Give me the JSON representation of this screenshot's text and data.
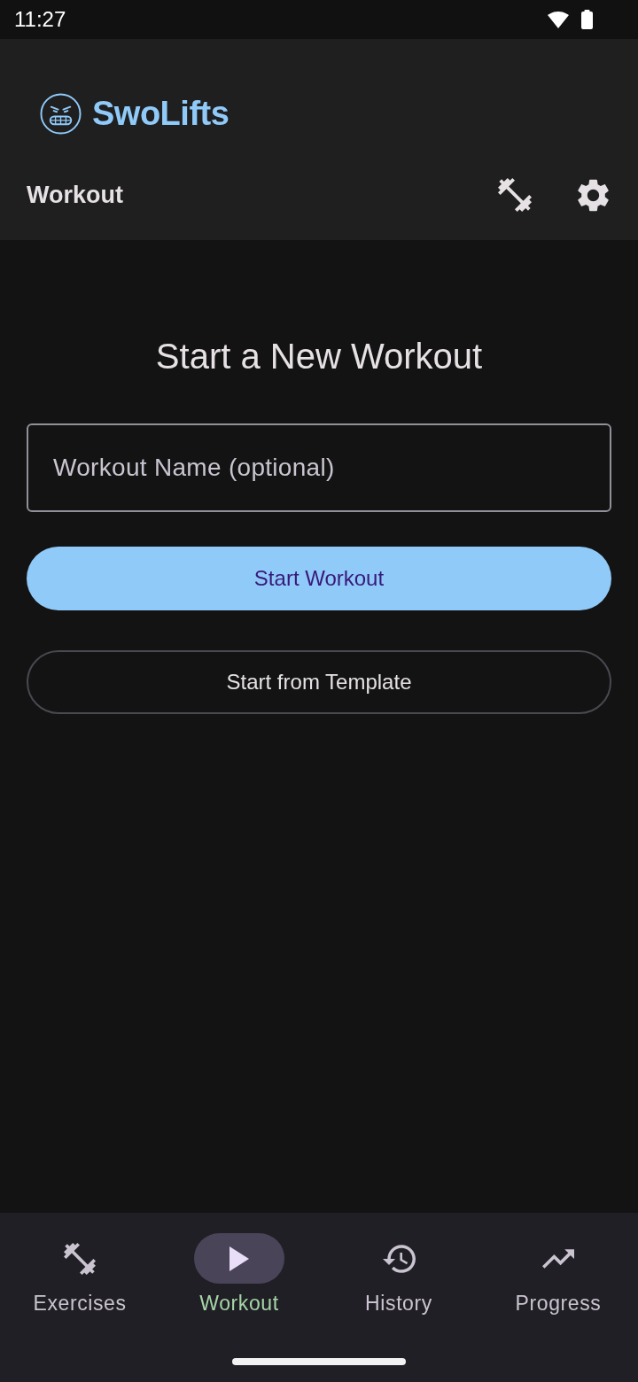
{
  "status_bar": {
    "time": "11:27"
  },
  "app_bar": {
    "brand": "SwoLifts",
    "title": "Workout"
  },
  "content": {
    "heading": "Start a New Workout",
    "name_field": {
      "placeholder": "Workout Name (optional)"
    },
    "buttons": [
      {
        "label": "Start Workout",
        "kind": "filled"
      },
      {
        "label": "Start from Template",
        "kind": "outlined"
      }
    ]
  },
  "bottom_nav": [
    {
      "label": "Exercises",
      "selected": false
    },
    {
      "label": "Workout",
      "selected": true
    },
    {
      "label": "History",
      "selected": false
    },
    {
      "label": "Progress",
      "selected": false
    }
  ]
}
